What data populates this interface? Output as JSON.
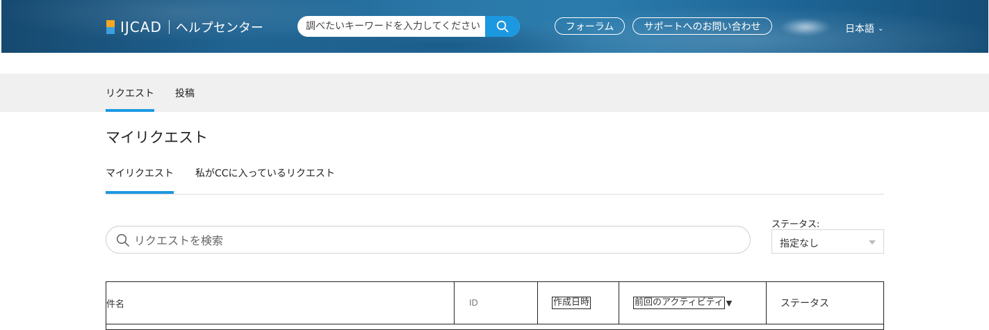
{
  "header": {
    "brand": "IJCAD",
    "subtitle": "ヘルプセンター",
    "search_placeholder": "調べたいキーワードを入力してください",
    "forum_label": "フォーラム",
    "support_label": "サポートへのお問い合わせ",
    "language": "日本語"
  },
  "subnav": {
    "requests": "リクエスト",
    "posts": "投稿"
  },
  "page": {
    "title": "マイリクエスト"
  },
  "tabs": {
    "mine": "マイリクエスト",
    "cc": "私がCCに入っているリクエスト"
  },
  "filter": {
    "search_placeholder": "リクエストを検索",
    "status_label": "ステータス:",
    "status_value": "指定なし"
  },
  "table": {
    "columns": {
      "subject": "件名",
      "id": "ID",
      "created": "作成日時",
      "activity": "前回のアクティビティ",
      "status": "ステータス"
    },
    "sort_indicator": "▼"
  },
  "colors": {
    "accent": "#1c98e0",
    "subnav_bg": "#f0f0f0"
  }
}
